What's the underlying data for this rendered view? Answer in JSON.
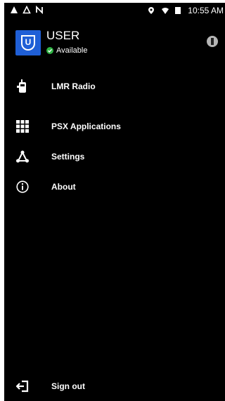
{
  "status_bar": {
    "left_icons": [
      "alert-icon",
      "outline-alert-icon",
      "n-icon"
    ],
    "right_icons": [
      "location-icon",
      "wifi-icon",
      "battery-icon"
    ],
    "time": "10:55 AM"
  },
  "profile": {
    "avatar_letter": "U",
    "name": "USER",
    "presence": "Available",
    "presence_color": "#2fb344",
    "avatar_color": "#1f5fd6"
  },
  "menu": {
    "items": [
      {
        "label": "LMR Radio",
        "icon": "radio-icon"
      },
      {
        "label": "PSX Applications",
        "icon": "grid-apps-icon"
      },
      {
        "label": "Settings",
        "icon": "settings-network-icon"
      },
      {
        "label": "About",
        "icon": "info-icon"
      }
    ],
    "sign_out": {
      "label": "Sign out",
      "icon": "sign-out-icon"
    }
  }
}
